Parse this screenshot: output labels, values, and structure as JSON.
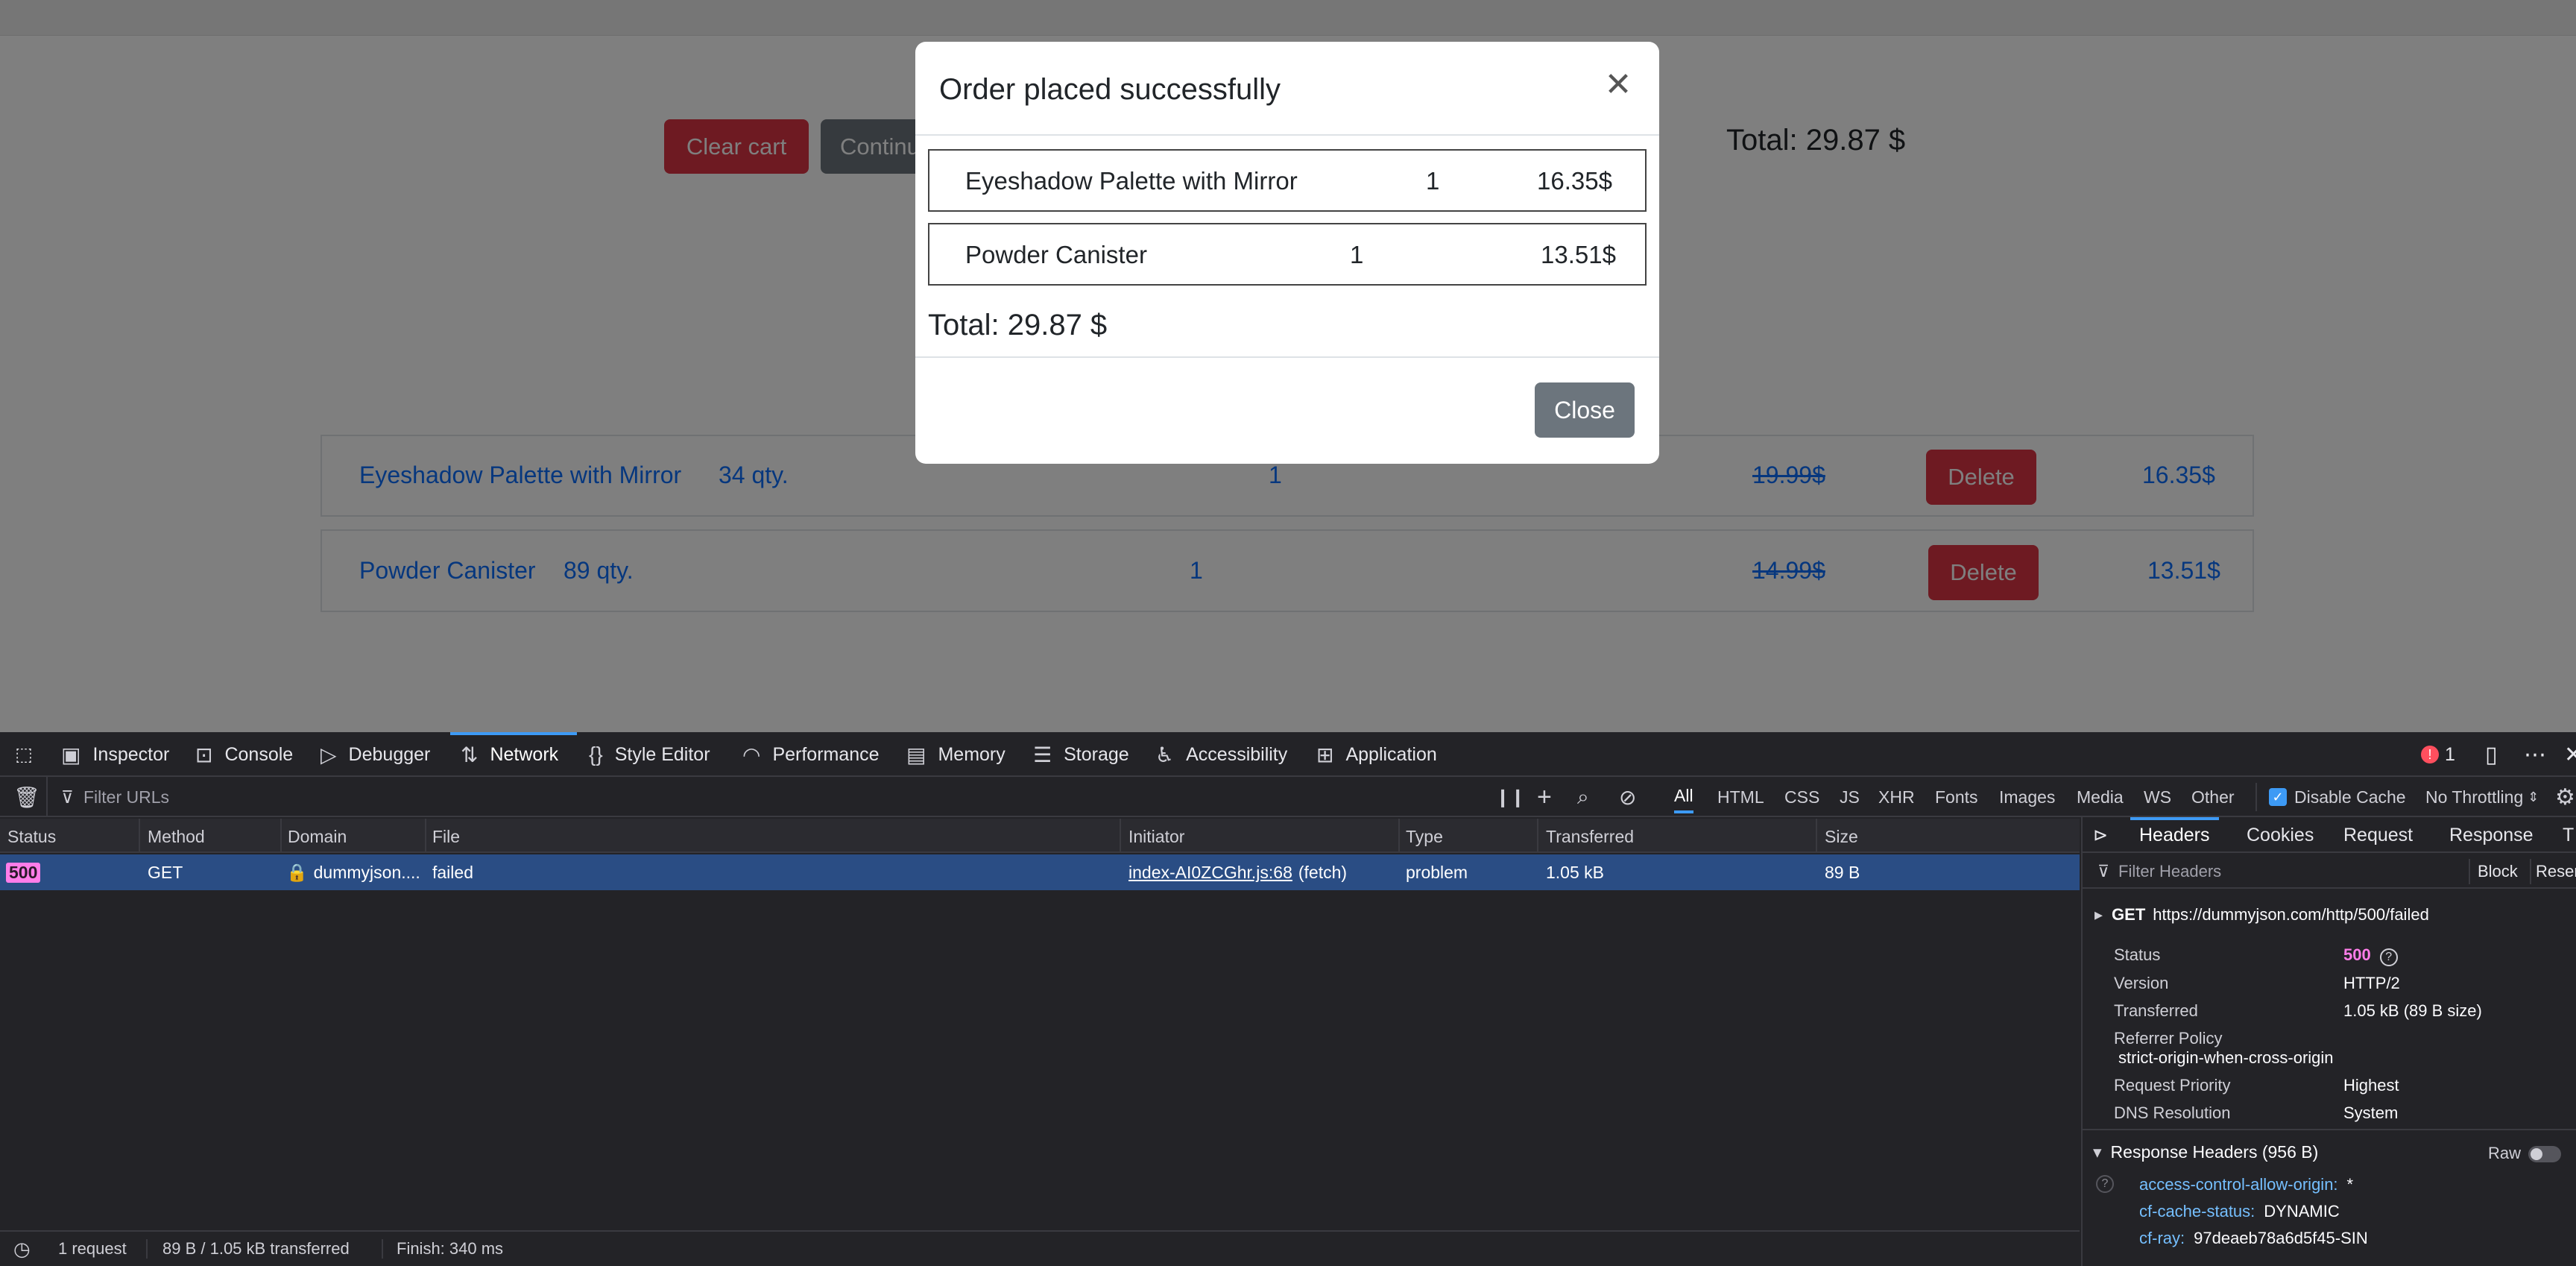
{
  "app": {
    "cart": {
      "clear_label": "Clear cart",
      "continue_label": "Continue",
      "total_label": "Total: 29.87 $",
      "items": [
        {
          "name": "Eyeshadow Palette with Mirror",
          "stock": "34 qty.",
          "quantity": "1",
          "old_price": "19.99$",
          "delete_label": "Delete",
          "price": "16.35$"
        },
        {
          "name": "Powder Canister",
          "stock": "89 qty.",
          "quantity": "1",
          "old_price": "14.99$",
          "delete_label": "Delete",
          "price": "13.51$"
        }
      ]
    },
    "modal": {
      "title": "Order placed successfully",
      "close_glyph": "✕",
      "items": [
        {
          "name": "Eyeshadow Palette with Mirror",
          "quantity": "1",
          "price": "16.35$"
        },
        {
          "name": "Powder Canister",
          "quantity": "1",
          "price": "13.51$"
        }
      ],
      "total_label": "Total: 29.87 $",
      "close_button_label": "Close"
    }
  },
  "devtools": {
    "tabs": [
      {
        "label": "Inspector",
        "icon": "inspector-icon"
      },
      {
        "label": "Console",
        "icon": "console-icon"
      },
      {
        "label": "Debugger",
        "icon": "debugger-icon"
      },
      {
        "label": "Network",
        "icon": "network-icon",
        "selected": true
      },
      {
        "label": "Style Editor",
        "icon": "style-editor-icon"
      },
      {
        "label": "Performance",
        "icon": "performance-icon"
      },
      {
        "label": "Memory",
        "icon": "memory-icon"
      },
      {
        "label": "Storage",
        "icon": "storage-icon"
      },
      {
        "label": "Accessibility",
        "icon": "accessibility-icon"
      },
      {
        "label": "Application",
        "icon": "application-icon"
      }
    ],
    "error_count": "1",
    "filter_placeholder": "Filter URLs",
    "type_filters": [
      "All",
      "HTML",
      "CSS",
      "JS",
      "XHR",
      "Fonts",
      "Images",
      "Media",
      "WS",
      "Other"
    ],
    "disable_cache_label": "Disable Cache",
    "throttling_label": "No Throttling",
    "columns": [
      "Status",
      "Method",
      "Domain",
      "File",
      "Initiator",
      "Type",
      "Transferred",
      "Size"
    ],
    "request": {
      "status": "500",
      "method": "GET",
      "domain": "dummyjson....",
      "file": "failed",
      "initiator_file": "index-AI0ZCGhr.js:68",
      "initiator_type": "(fetch)",
      "type": "problem",
      "transferred": "1.05 kB",
      "size": "89 B"
    },
    "side_tabs": [
      "Headers",
      "Cookies",
      "Request",
      "Response",
      "T"
    ],
    "filter_headers_placeholder": "Filter Headers",
    "block_label": "Block",
    "resend_label": "Resen",
    "request_line": {
      "method": "GET",
      "url": "https://dummyjson.com/http/500/failed"
    },
    "details": [
      {
        "key": "Status",
        "value": "500"
      },
      {
        "key": "Version",
        "value": "HTTP/2"
      },
      {
        "key": "Transferred",
        "value": "1.05 kB (89 B size)"
      },
      {
        "key": "Referrer Policy",
        "value": "strict-origin-when-cross-origin"
      },
      {
        "key": "Request Priority",
        "value": "Highest"
      },
      {
        "key": "DNS Resolution",
        "value": "System"
      }
    ],
    "response_headers_label": "Response Headers (956 B)",
    "raw_label": "Raw",
    "response_headers": [
      {
        "key": "access-control-allow-origin:",
        "value": "*"
      },
      {
        "key": "cf-cache-status:",
        "value": "DYNAMIC"
      },
      {
        "key": "cf-ray:",
        "value": "97deaeb78a6d5f45-SIN"
      }
    ],
    "status_bar": {
      "requests": "1 request",
      "transferred": "89 B / 1.05 kB transferred",
      "finish": "Finish: 340 ms"
    },
    "colors": {
      "selected_row": "#2a4d84",
      "status_error": "#ff7de9",
      "tab_accent": "#3d9af5"
    }
  }
}
